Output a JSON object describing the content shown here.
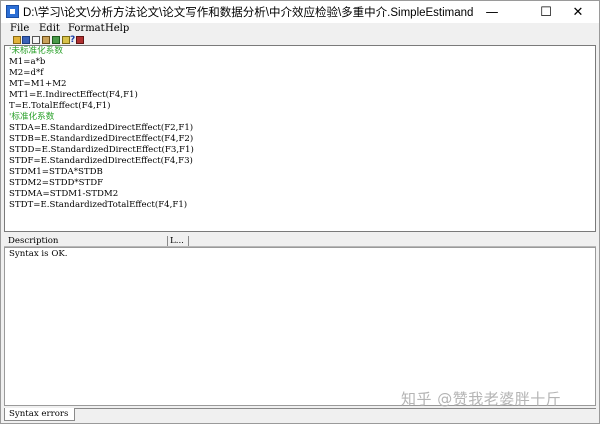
{
  "window": {
    "title": "D:\\学习\\论文\\分析方法论文\\论文写作和数据分析\\中介效应检验\\多重中介.SimpleEstimand",
    "minimize_glyph": "—",
    "maximize_glyph": "☐",
    "close_glyph": "✕"
  },
  "menu": {
    "file": "File",
    "edit": "Edit",
    "format": "Format",
    "help": "Help"
  },
  "toolbar": {
    "icons": [
      "open-icon",
      "save-icon",
      "copy-icon",
      "paste-icon",
      "run-icon",
      "check-icon",
      "help-icon",
      "book-icon"
    ],
    "help_glyph": "?"
  },
  "editor": {
    "lines": [
      "'未标准化系数",
      "M1=a*b",
      "M2=d*f",
      "MT=M1+M2",
      "MT1=E.IndirectEffect(F4,F1)",
      "T=E.TotalEffect(F4,F1)",
      "'标准化系数",
      "STDA=E.StandardizedDirectEffect(F2,F1)",
      "STDB=E.StandardizedDirectEffect(F4,F2)",
      "STDD=E.StandardizedDirectEffect(F3,F1)",
      "STDF=E.StandardizedDirectEffect(F4,F3)",
      "STDM1=STDA*STDB",
      "STDM2=STDD*STDF",
      "STDMA=STDM1-STDM2",
      "STDT=E.StandardizedTotalEffect(F4,F1)"
    ]
  },
  "messages": {
    "col_description": "Description",
    "col_line": "L...",
    "text": "Syntax is OK."
  },
  "tabs": {
    "syntax_errors": "Syntax errors"
  },
  "watermark": "知乎 @赞我老婆胖十斤",
  "colors": {
    "comment": "#2aa12a",
    "text": "#000000",
    "watermark": "#b4b4b4"
  }
}
